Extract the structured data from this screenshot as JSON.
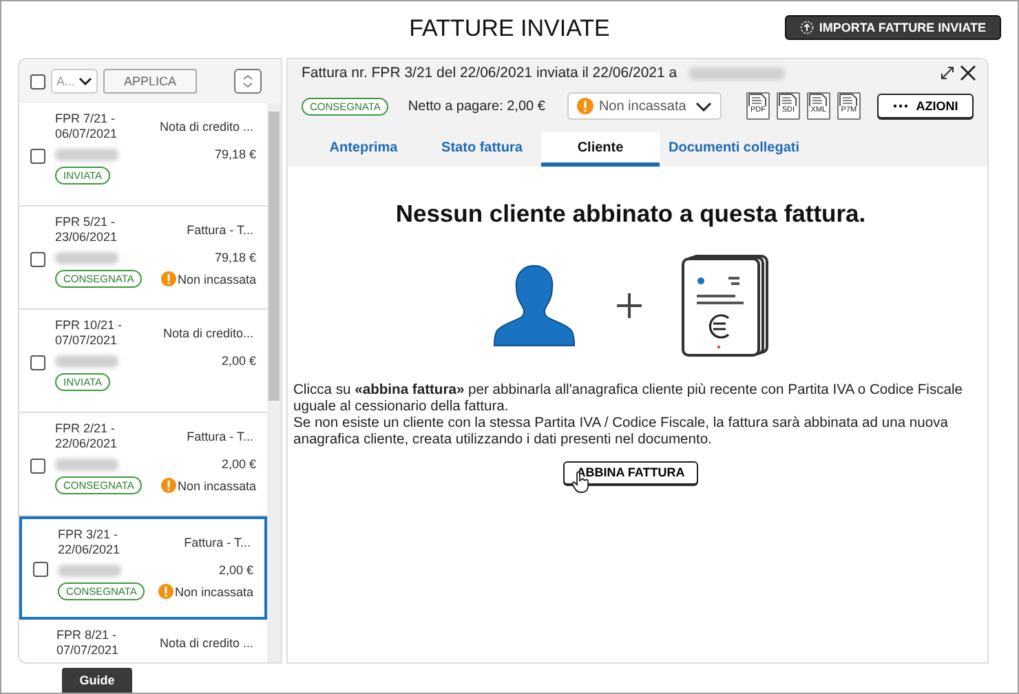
{
  "page_title": "FATTURE INVIATE",
  "import_button": "IMPORTA FATTURE INVIATE",
  "list_toolbar": {
    "bulk_checked": false,
    "action_select": "A...",
    "apply_button": "APPLICA"
  },
  "invoices": [
    {
      "number": "FPR 7/21 -",
      "date": "06/07/2021",
      "type": "Nota di credito ...",
      "amount": "79,18 €",
      "status": "INVIATA",
      "checked": false,
      "selected": false
    },
    {
      "number": "FPR 5/21 -",
      "date": "23/06/2021",
      "type": "Fattura - T...",
      "amount": "79,18 €",
      "status": "CONSEGNATA",
      "payment": "Non incassata",
      "checked": false,
      "selected": false
    },
    {
      "number": "FPR 10/21 -",
      "date": "07/07/2021",
      "type": "Nota di credito...",
      "amount": "2,00 €",
      "status": "INVIATA",
      "checked": false,
      "selected": false
    },
    {
      "number": "FPR 2/21 -",
      "date": "22/06/2021",
      "type": "Fattura - T...",
      "amount": "2,00 €",
      "status": "CONSEGNATA",
      "payment": "Non incassata",
      "checked": false,
      "selected": false
    },
    {
      "number": "FPR 3/21 -",
      "date": "22/06/2021",
      "type": "Fattura - T...",
      "amount": "2,00 €",
      "status": "CONSEGNATA",
      "payment": "Non incassata",
      "checked": false,
      "selected": true
    },
    {
      "number": "FPR 8/21 -",
      "date": "07/07/2021",
      "type": "Nota di credito ...",
      "selected": false
    }
  ],
  "detail": {
    "title": "Fattura nr. FPR 3/21 del 22/06/2021 inviata il 22/06/2021 a",
    "status": "CONSEGNATA",
    "net": "Netto a pagare: 2,00 €",
    "payment_select": "Non incassata",
    "file_icons": [
      "PDF",
      "SDI",
      "XML",
      "P7M"
    ],
    "actions_button": "AZIONI",
    "tabs": [
      {
        "label": "Anteprima",
        "selected": false
      },
      {
        "label": "Stato fattura",
        "selected": false
      },
      {
        "label": "Cliente",
        "selected": true
      },
      {
        "label": "Documenti collegati",
        "selected": false
      }
    ],
    "heading": "Nessun cliente abbinato a questa fattura.",
    "paragraphs": [
      "Clicca su **«abbina fattura»** per abbinarla all'anagrafica cliente più recente con Partita IVA o Codice Fiscale uguale al cessionario della fattura.",
      "Se non esiste un cliente con la stessa Partita IVA / Codice Fiscale, la fattura sarà abbinata ad una nuova anagrafica cliente, creata utilizzando i dati presenti nel documento."
    ],
    "match_button": "ABBINA FATTURA"
  },
  "guide_tab": "Guide"
}
